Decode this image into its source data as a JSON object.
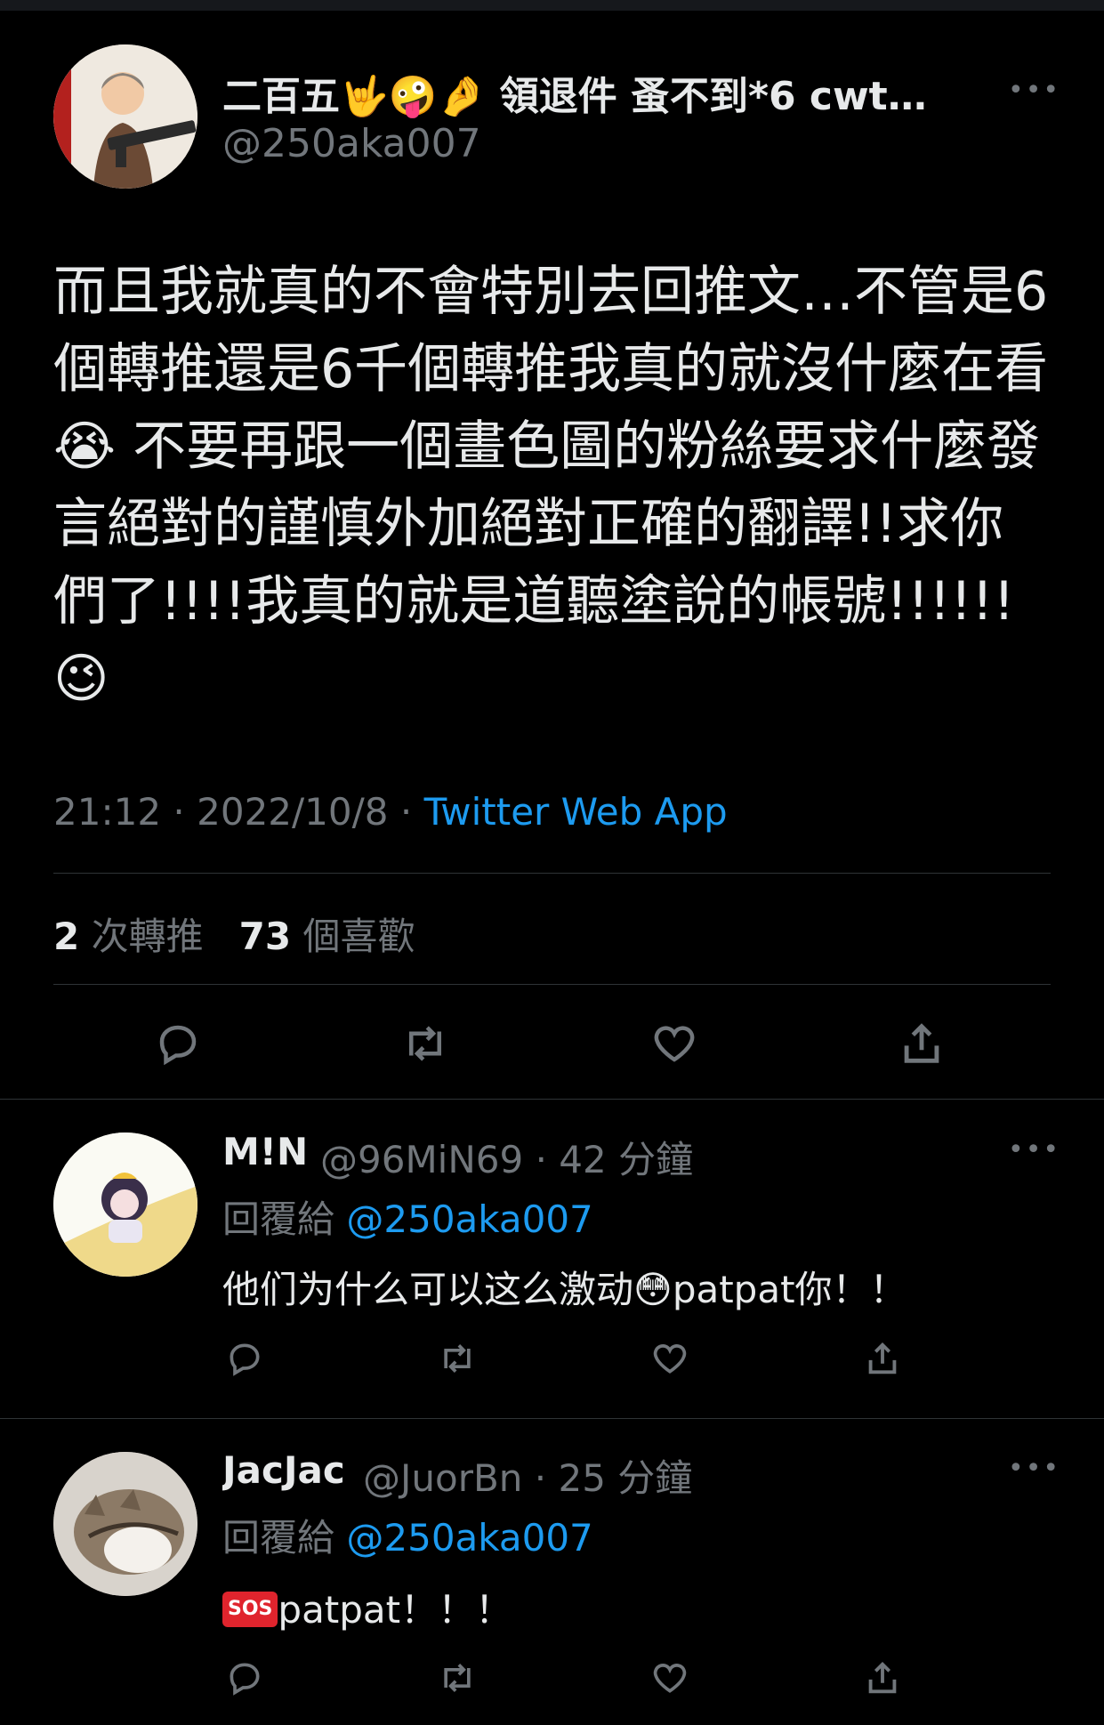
{
  "main_tweet": {
    "display_name": "二百五🤟🤪🤌 領退件 蚤不到*6 cwt…",
    "handle": "@250aka007",
    "more_label": "•••",
    "text": "而且我就真的不會特別去回推文…不管是6個轉推還是6千個轉推我真的就沒什麼在看😭 不要再跟一個畫色圖的粉絲要求什麼發言絕對的謹慎外加絕對正確的翻譯!!求你們了!!!!我真的就是道聽塗說的帳號!!!!!!😉",
    "time": "21:12",
    "date": "2022/10/8",
    "separator": "·",
    "source": "Twitter Web App",
    "retweet_count": "2",
    "retweet_label": "次轉推",
    "like_count": "73",
    "like_label": "個喜歡"
  },
  "replies": [
    {
      "display_name": "M!N",
      "handle": "@96MiN69",
      "time_ago": "· 42 分鐘",
      "reply_prefix": "回覆給",
      "reply_mention": "@250aka007",
      "text_before": "他们为什么可以这么激动",
      "emoji": "😳",
      "text_after": "patpat你！！",
      "more_label": "•••"
    },
    {
      "display_name": "JacJac",
      "handle": "@JuorBn",
      "time_ago": "· 25 分鐘",
      "reply_prefix": "回覆給",
      "reply_mention": "@250aka007",
      "badge": "SOS",
      "text_after": "patpat！！！",
      "more_label": "•••"
    }
  ],
  "icons": [
    "reply-icon",
    "retweet-icon",
    "like-icon",
    "share-icon",
    "more-icon"
  ],
  "colors": {
    "background": "#000000",
    "text": "#e7e9ea",
    "muted": "#71767b",
    "link": "#1d9bf0",
    "divider": "#2f3336"
  }
}
